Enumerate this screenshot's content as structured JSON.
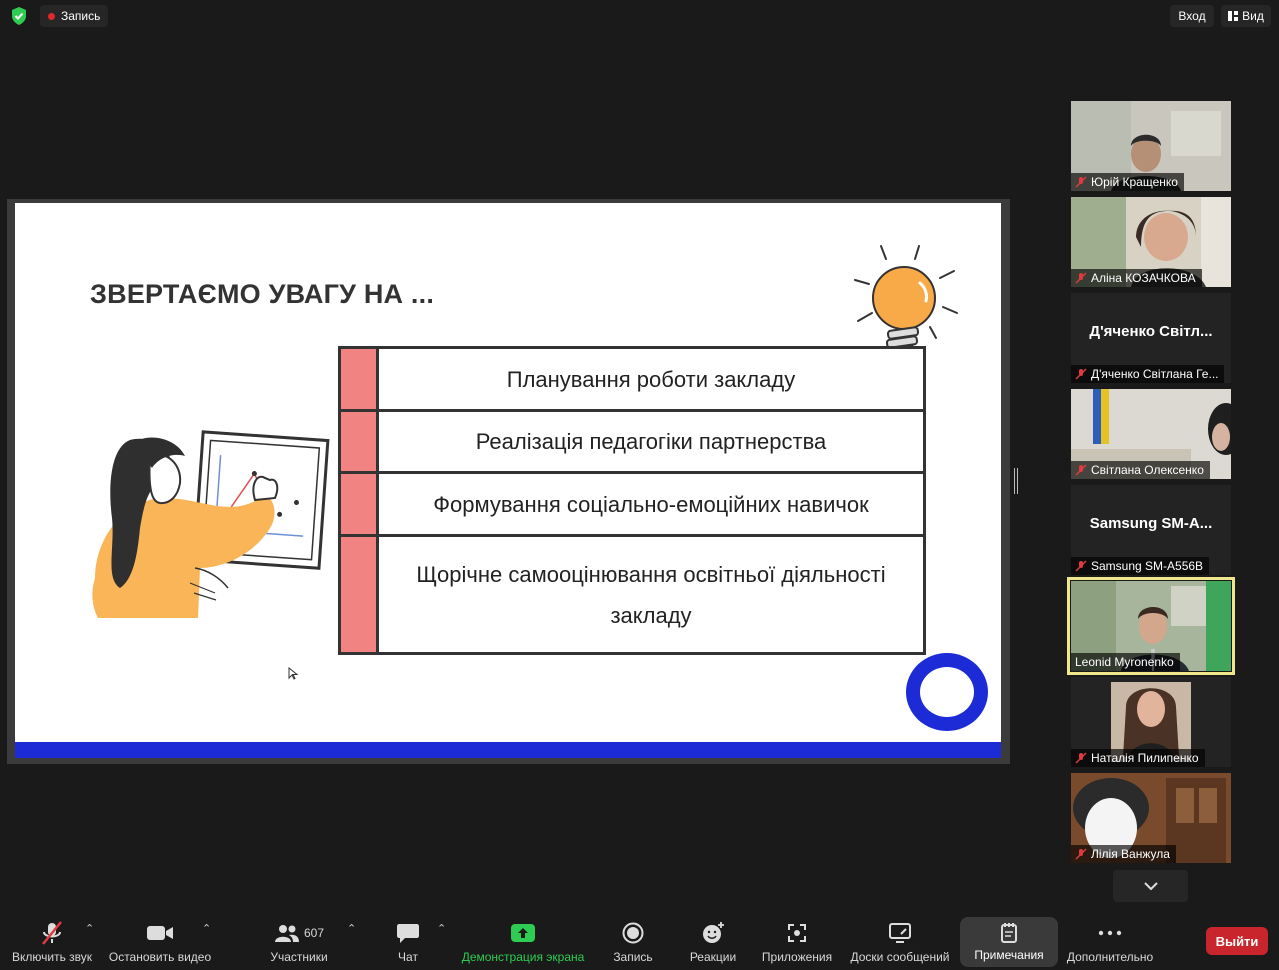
{
  "topbar": {
    "recording_label": "Запись",
    "enter_label": "Вход",
    "view_label": "Вид"
  },
  "slide": {
    "title": "ЗВЕРТАЄМО УВАГУ НА ...",
    "items": [
      "Планування роботи закладу",
      "Реалізація педагогіки партнерства",
      "Формування соціально-емоційних навичок",
      "Щорічне самооцінювання освітньої діяльності закладу"
    ]
  },
  "participants": [
    {
      "name": "Юрій Кращенко",
      "video": true,
      "muted": true
    },
    {
      "name": "Аліна КОЗАЧКОВА",
      "video": true,
      "muted": true
    },
    {
      "name": "Д'яченко Світлана Ге...",
      "display": "Д'яченко  Світл...",
      "video": false,
      "muted": true
    },
    {
      "name": "Світлана Олексенко",
      "video": true,
      "muted": true
    },
    {
      "name": "Samsung SM-A556B",
      "display": "Samsung  SM-A...",
      "video": false,
      "muted": true
    },
    {
      "name": "Leonid Myronenko",
      "video": true,
      "muted": false,
      "active": true
    },
    {
      "name": "Наталія Пилипенко",
      "video": true,
      "muted": true
    },
    {
      "name": "Лілія Ванжула",
      "video": true,
      "muted": true
    }
  ],
  "toolbar": {
    "unmute_label": "Включить звук",
    "stop_video_label": "Остановить видео",
    "participants_label": "Участники",
    "participants_count": "607",
    "chat_label": "Чат",
    "share_label": "Демонстрация экрана",
    "record_label": "Запись",
    "reactions_label": "Реакции",
    "apps_label": "Приложения",
    "whiteboards_label": "Доски сообщений",
    "notes_label": "Примечания",
    "more_label": "Дополнительно",
    "leave_label": "Выйти"
  },
  "colors": {
    "accent_green": "#2ecc52",
    "leave_red": "#c8262c",
    "slide_blue": "#1c2bd6",
    "slide_pink": "#f28383",
    "active_speaker": "#f0e68c"
  }
}
